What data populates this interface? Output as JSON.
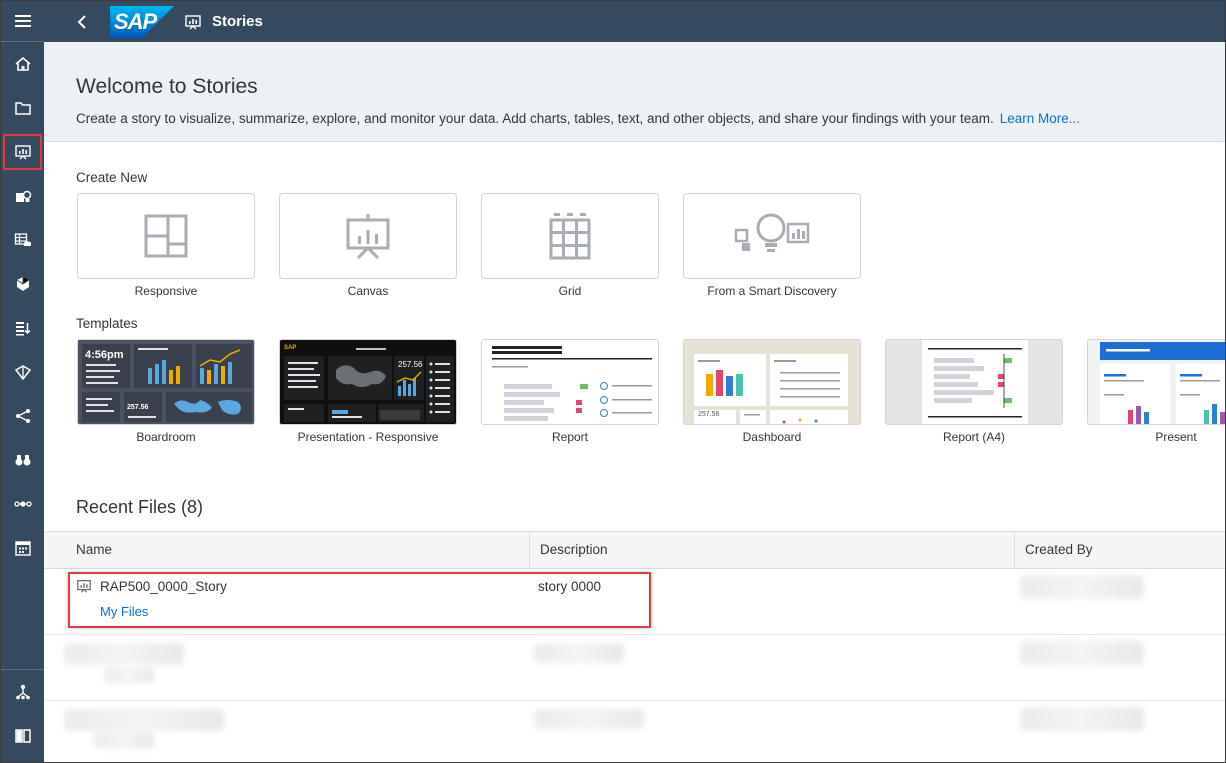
{
  "shell": {
    "logo_text": "SAP",
    "title": "Stories"
  },
  "nav": {
    "items": [
      {
        "name": "menu-icon"
      },
      {
        "name": "home-icon"
      },
      {
        "name": "files-icon"
      },
      {
        "name": "stories-icon"
      },
      {
        "name": "analytic-app-icon"
      },
      {
        "name": "modeler-icon"
      },
      {
        "name": "data-analyzer-icon"
      },
      {
        "name": "data-import-icon"
      },
      {
        "name": "predictive-icon"
      },
      {
        "name": "connections-icon"
      },
      {
        "name": "explore-icon"
      },
      {
        "name": "workflow-icon"
      },
      {
        "name": "calendar-icon"
      },
      {
        "name": "network-icon"
      },
      {
        "name": "help-book-icon"
      }
    ]
  },
  "welcome": {
    "title": "Welcome to Stories",
    "description": "Create a story to visualize, summarize, explore, and monitor your data. Add charts, tables, text, and other objects, and share your findings with your team.",
    "link": "Learn More..."
  },
  "create_new": {
    "title": "Create New",
    "tiles": [
      {
        "label": "Responsive"
      },
      {
        "label": "Canvas"
      },
      {
        "label": "Grid"
      },
      {
        "label": "From a Smart Discovery"
      }
    ]
  },
  "templates": {
    "title": "Templates",
    "items": [
      {
        "label": "Boardroom",
        "clock": "4:56pm",
        "value": "257.56"
      },
      {
        "label": "Presentation - Responsive",
        "brand": "SAP",
        "value": "257.56"
      },
      {
        "label": "Report"
      },
      {
        "label": "Dashboard",
        "value": "257.56"
      },
      {
        "label": "Report (A4)"
      },
      {
        "label": "Present"
      }
    ]
  },
  "recent": {
    "title": "Recent Files (8)",
    "columns": [
      "Name",
      "Description",
      "Created By"
    ],
    "rows": [
      {
        "name": "RAP500_0000_Story",
        "location": "My Files",
        "description": "story 0000"
      }
    ]
  },
  "colors": {
    "shell_bg": "#354a5f",
    "accent": "#0a6ed1",
    "highlight": "#e5383f"
  }
}
